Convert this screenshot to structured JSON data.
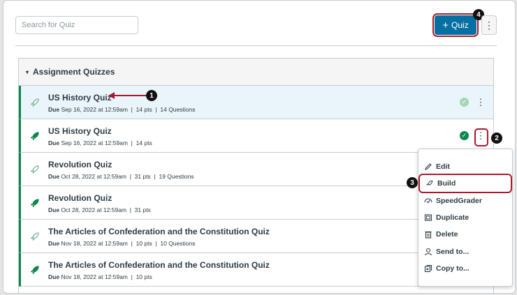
{
  "search": {
    "placeholder": "Search for Quiz"
  },
  "toolbar": {
    "add_quiz_label": "Quiz",
    "plus_glyph": "+",
    "more_glyph": "⋮"
  },
  "callouts": [
    "1",
    "2",
    "3",
    "4"
  ],
  "group": {
    "title": "Assignment Quizzes",
    "caret": "▾",
    "quizzes": [
      {
        "title": "US History Quiz",
        "due_label": "Due",
        "due": "Sep 16, 2022 at 12:59am",
        "points": "14 pts",
        "questions": "14 Questions",
        "published": false,
        "highlight": true
      },
      {
        "title": "US History Quiz",
        "due_label": "Due",
        "due": "Sep 16, 2022 at 12:59am",
        "points": "14 pts",
        "questions": "",
        "published": true,
        "highlight": false
      },
      {
        "title": "Revolution Quiz",
        "due_label": "Due",
        "due": "Oct 28, 2022 at 12:59am",
        "points": "31 pts",
        "questions": "19 Questions",
        "published": false,
        "highlight": false
      },
      {
        "title": "Revolution Quiz",
        "due_label": "Due",
        "due": "Oct 28, 2022 at 12:59am",
        "points": "31 pts",
        "questions": "",
        "published": true,
        "highlight": false
      },
      {
        "title": "The Articles of Confederation and the Constitution Quiz",
        "due_label": "Due",
        "due": "Nov 18, 2022 at 12:59am",
        "points": "10 pts",
        "questions": "10 Questions",
        "published": false,
        "highlight": false
      },
      {
        "title": "The Articles of Confederation and the Constitution Quiz",
        "due_label": "Due",
        "due": "Nov 18, 2022 at 12:59am",
        "points": "10 pts",
        "questions": "",
        "published": true,
        "highlight": false
      }
    ]
  },
  "menu": {
    "items": [
      {
        "label": "Edit",
        "icon": "pencil-icon"
      },
      {
        "label": "Build",
        "icon": "rocket-icon"
      },
      {
        "label": "SpeedGrader",
        "icon": "speedgrader-icon"
      },
      {
        "label": "Duplicate",
        "icon": "duplicate-icon"
      },
      {
        "label": "Delete",
        "icon": "trash-icon"
      },
      {
        "label": "Send to...",
        "icon": "user-icon"
      },
      {
        "label": "Copy to...",
        "icon": "copy-icon"
      }
    ]
  },
  "colors": {
    "accent": "#0770a3",
    "published": "#0b874b",
    "unpublished": "#a5d6b5",
    "callout_outline": "#a8192c"
  }
}
